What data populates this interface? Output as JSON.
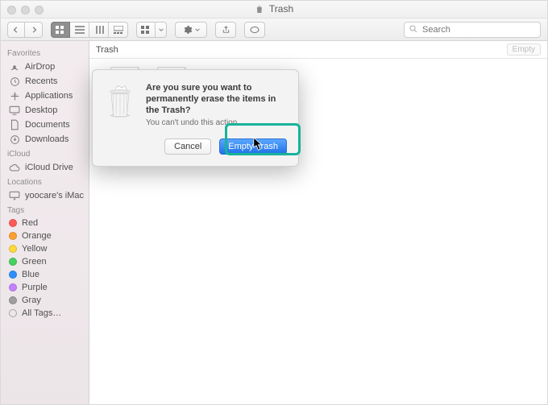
{
  "window": {
    "title": "Trash"
  },
  "toolbar": {
    "search_placeholder": "Search"
  },
  "pathbar": {
    "location": "Trash",
    "empty_button": "Empty"
  },
  "sidebar": {
    "sections": [
      {
        "header": "Favorites",
        "items": [
          {
            "label": "AirDrop",
            "icon": "airdrop"
          },
          {
            "label": "Recents",
            "icon": "clock"
          },
          {
            "label": "Applications",
            "icon": "apps"
          },
          {
            "label": "Desktop",
            "icon": "desktop"
          },
          {
            "label": "Documents",
            "icon": "doc"
          },
          {
            "label": "Downloads",
            "icon": "downloads"
          }
        ]
      },
      {
        "header": "iCloud",
        "items": [
          {
            "label": "iCloud Drive",
            "icon": "cloud"
          }
        ]
      },
      {
        "header": "Locations",
        "items": [
          {
            "label": "yoocare's iMac",
            "icon": "imac"
          }
        ]
      },
      {
        "header": "Tags",
        "items": [
          {
            "label": "Red",
            "color": "#ff5b57"
          },
          {
            "label": "Orange",
            "color": "#ffa030"
          },
          {
            "label": "Yellow",
            "color": "#ffd93a"
          },
          {
            "label": "Green",
            "color": "#46d260"
          },
          {
            "label": "Blue",
            "color": "#2f8fff"
          },
          {
            "label": "Purple",
            "color": "#c582ff"
          },
          {
            "label": "Gray",
            "color": "#9f9f9f"
          },
          {
            "label": "All Tags…",
            "open": true
          }
        ]
      }
    ]
  },
  "files": [
    {
      "kind": "ZIP"
    },
    {
      "kind": "ZIP"
    }
  ],
  "dialog": {
    "headline": "Are you sure you want to permanently erase the items in the Trash?",
    "sub": "You can't undo this action.",
    "cancel": "Cancel",
    "confirm": "Empty Trash"
  }
}
